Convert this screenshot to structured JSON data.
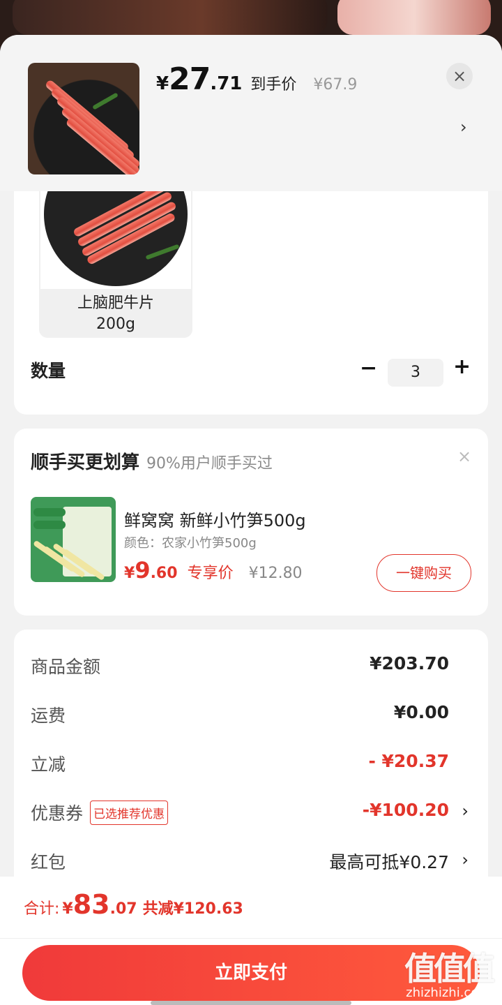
{
  "header": {
    "price_yen": "¥",
    "price_int": "27",
    "price_dec": ".71",
    "price_tag": "到手价",
    "original_price": "¥67.9",
    "close_icon": "close-icon",
    "chevron": "›"
  },
  "variant": {
    "name": "上脑肥牛片",
    "weight": "200g"
  },
  "quantity": {
    "label": "数量",
    "minus": "−",
    "value": "3",
    "plus": "+"
  },
  "upsell": {
    "title": "顺手买更划算",
    "subtitle": "90%用户顺手买过",
    "close": "×",
    "product_name": "鲜窝窝 新鲜小竹笋500g",
    "spec": "颜色：农家小竹笋500g",
    "price_yen": "¥",
    "price_int": "9",
    "price_dec": ".60",
    "price_tag": "专享价",
    "original_price": "¥12.80",
    "buy_label": "一键购买"
  },
  "summary": {
    "rows": [
      {
        "label": "商品金额",
        "value": "¥203.70"
      },
      {
        "label": "运费",
        "value": "¥0.00"
      },
      {
        "label": "立减",
        "value": "- ¥20.37"
      },
      {
        "label": "优惠券",
        "badge": "已选推荐优惠",
        "value": "-¥100.20"
      },
      {
        "label": "红包",
        "value": "最高可抵¥0.27"
      }
    ],
    "chevron": "›"
  },
  "footer": {
    "total_label": "合计:",
    "total_yen": "¥",
    "total_int": "83",
    "total_dec": ".07",
    "discount_text": "共减¥120.63",
    "pay_label": "立即支付",
    "watermark_logo": "值值值",
    "watermark_url": "zhizhizhi.com"
  },
  "colors": {
    "accent_red": "#e2352b",
    "pay_gradient_start": "#f03a3a",
    "pay_gradient_end": "#ff5a3c"
  }
}
